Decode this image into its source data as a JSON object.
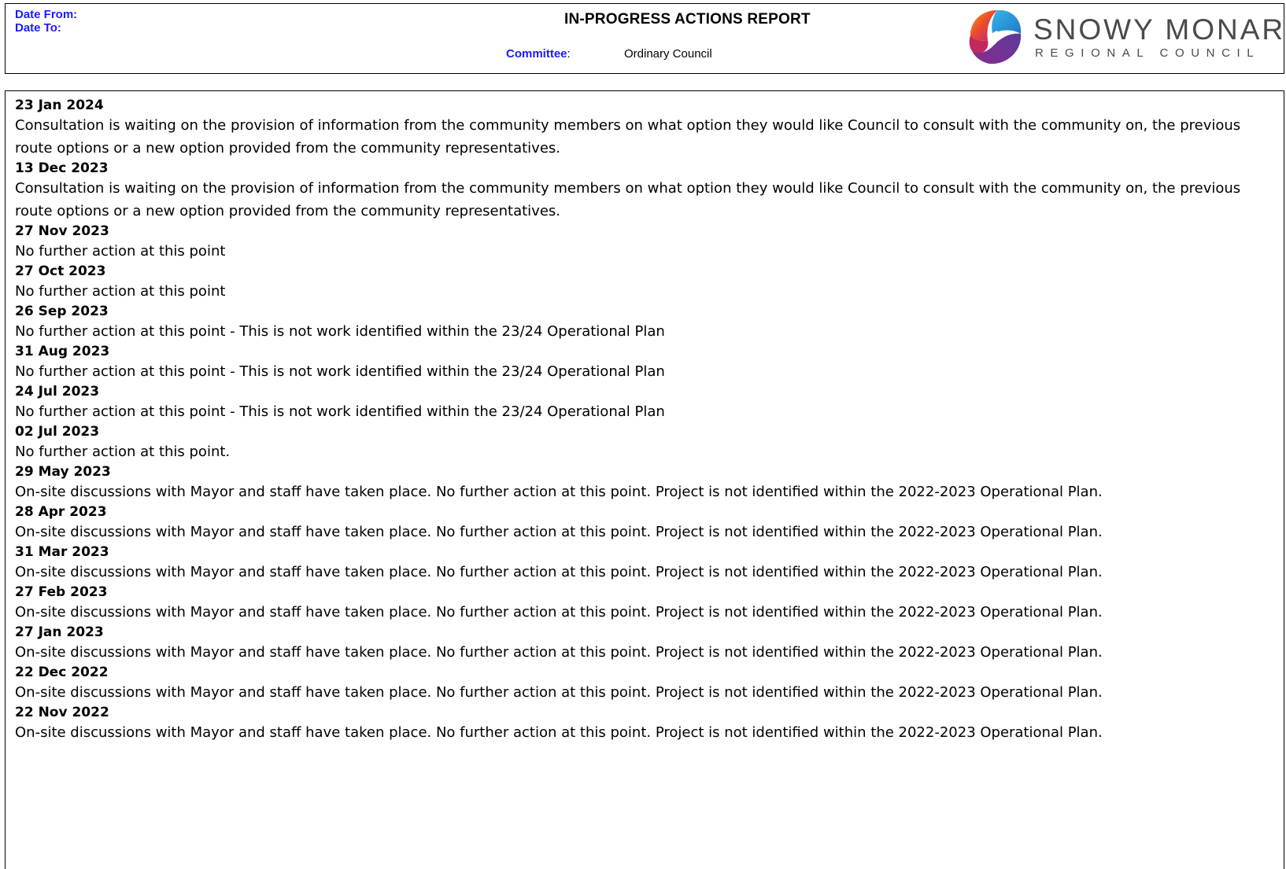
{
  "header": {
    "date_from_label": "Date From:",
    "date_to_label": "Date To:",
    "title": "IN-PROGRESS ACTIONS REPORT",
    "committee_label": "Committee",
    "committee_colon": ":",
    "committee_value": "Ordinary Council",
    "logo_name": "SNOWY MONARO",
    "logo_subtitle": "REGIONAL COUNCIL"
  },
  "colors": {
    "label_blue": "#1a1aff",
    "logo_text": "#4a4a4a"
  },
  "entries": [
    {
      "date": "23 Jan 2024",
      "text": "Consultation is waiting on the provision of information from the community members on what option they would like Council to consult with the community on, the previous route options or a new option provided from the community representatives."
    },
    {
      "date": "13 Dec 2023",
      "text": "Consultation is waiting on the provision of information from the community members on what option they would like Council to consult with the community on, the previous route options or a new option provided from the community representatives."
    },
    {
      "date": "27 Nov 2023",
      "text": "No further action at this point"
    },
    {
      "date": "27 Oct 2023",
      "text": "No further action at this point"
    },
    {
      "date": "26 Sep 2023",
      "text": "No further action at this point - This is not work identified within the 23/24 Operational Plan"
    },
    {
      "date": "31 Aug 2023",
      "text": "No further action at this point - This is not work identified within the 23/24 Operational Plan"
    },
    {
      "date": "24 Jul 2023",
      "text": "No further action at this point - This is not work identified within the 23/24 Operational Plan"
    },
    {
      "date": "02 Jul 2023",
      "text": "No further action at this point."
    },
    {
      "date": "29 May 2023",
      "text": "On-site discussions with Mayor and staff have taken place. No further action at this point. Project is not identified within the 2022-2023 Operational Plan."
    },
    {
      "date": "28 Apr 2023",
      "text": "On-site discussions with Mayor and staff have taken place. No further action at this point. Project is not identified within the 2022-2023 Operational Plan."
    },
    {
      "date": "31 Mar 2023",
      "text": "On-site discussions with Mayor and staff have taken place. No further action at this point. Project is not identified within the 2022-2023 Operational Plan."
    },
    {
      "date": "27 Feb 2023",
      "text": "On-site discussions with Mayor and staff have taken place. No further action at this point. Project is not identified within the 2022-2023 Operational Plan."
    },
    {
      "date": "27 Jan 2023",
      "text": "On-site discussions with Mayor and staff have taken place. No further action at this point. Project is not identified within the 2022-2023 Operational Plan."
    },
    {
      "date": "22 Dec 2022",
      "text": "On-site discussions with Mayor and staff have taken place. No further action at this point. Project is not identified within the 2022-2023 Operational Plan."
    },
    {
      "date": "22 Nov 2022",
      "text": "On-site discussions with Mayor and staff have taken place. No further action at this point. Project is not identified within the 2022-2023 Operational Plan."
    }
  ]
}
